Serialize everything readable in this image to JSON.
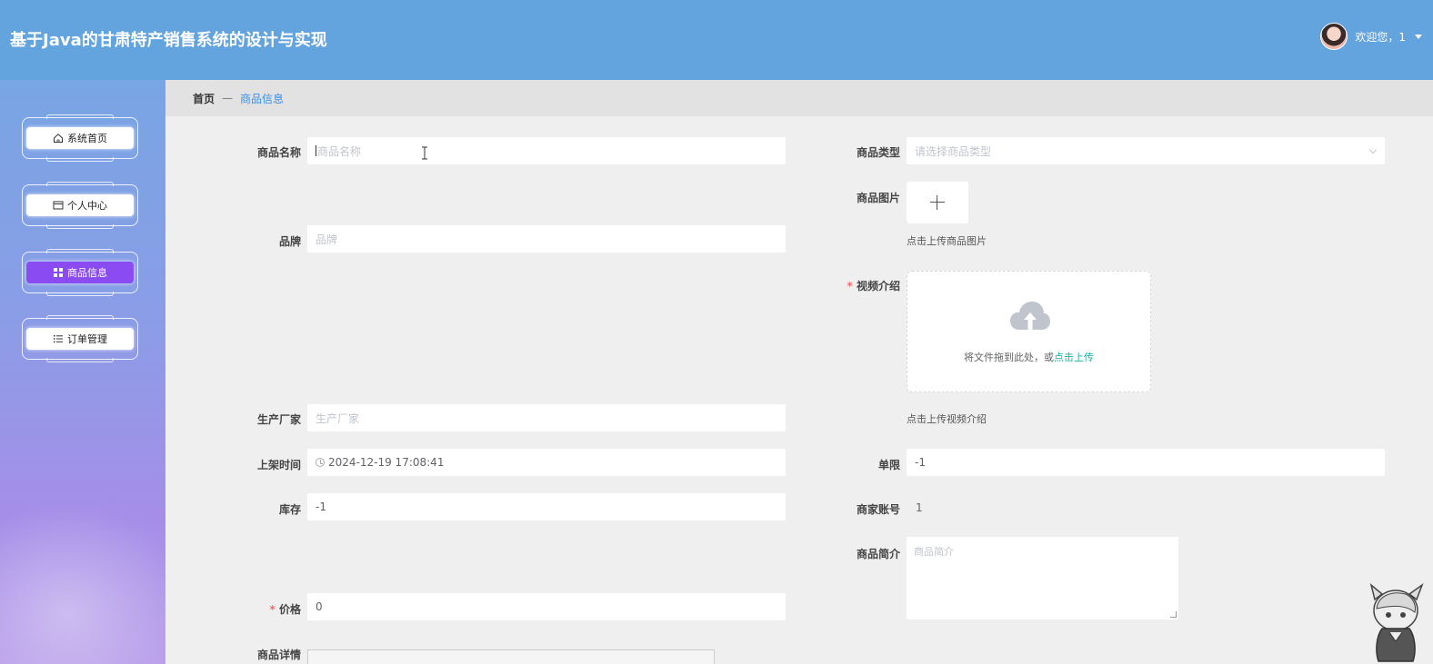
{
  "app": {
    "title": "基于Java的甘肃特产销售系统的设计与实现"
  },
  "user": {
    "welcome": "欢迎您，1"
  },
  "sidebar": {
    "items": [
      {
        "label": "系统首页",
        "icon": "home-icon"
      },
      {
        "label": "个人中心",
        "icon": "card-icon"
      },
      {
        "label": "商品信息",
        "icon": "grid-icon",
        "active": true
      },
      {
        "label": "订单管理",
        "icon": "list-icon"
      }
    ]
  },
  "breadcrumb": {
    "home": "首页",
    "separator": "—",
    "current": "商品信息"
  },
  "form": {
    "name": {
      "label": "商品名称",
      "placeholder": "商品名称"
    },
    "category": {
      "label": "商品类型",
      "placeholder": "请选择商品类型"
    },
    "image": {
      "label": "商品图片",
      "hint": "点击上传商品图片"
    },
    "brand": {
      "label": "品牌",
      "placeholder": "品牌"
    },
    "video": {
      "label": "视频介绍",
      "drag_text": "将文件拖到此处，或",
      "drag_link": "点击上传",
      "hint": "点击上传视频介绍"
    },
    "manufacturer": {
      "label": "生产厂家",
      "placeholder": "生产厂家"
    },
    "listing_time": {
      "label": "上架时间",
      "value": "2024-12-19 17:08:41"
    },
    "limit": {
      "label": "单限",
      "value": "-1"
    },
    "stock": {
      "label": "库存",
      "value": "-1"
    },
    "merchant": {
      "label": "商家账号",
      "value": "1"
    },
    "intro": {
      "label": "商品简介",
      "placeholder": "商品简介"
    },
    "price": {
      "label": "价格",
      "value": "0"
    },
    "detail": {
      "label": "商品详情"
    }
  },
  "colors": {
    "header": "#63a3de",
    "active_nav": "#8a4cf2",
    "link": "#3a8ee6",
    "upload_link": "#17b3a3",
    "required": "#f56c6c"
  }
}
